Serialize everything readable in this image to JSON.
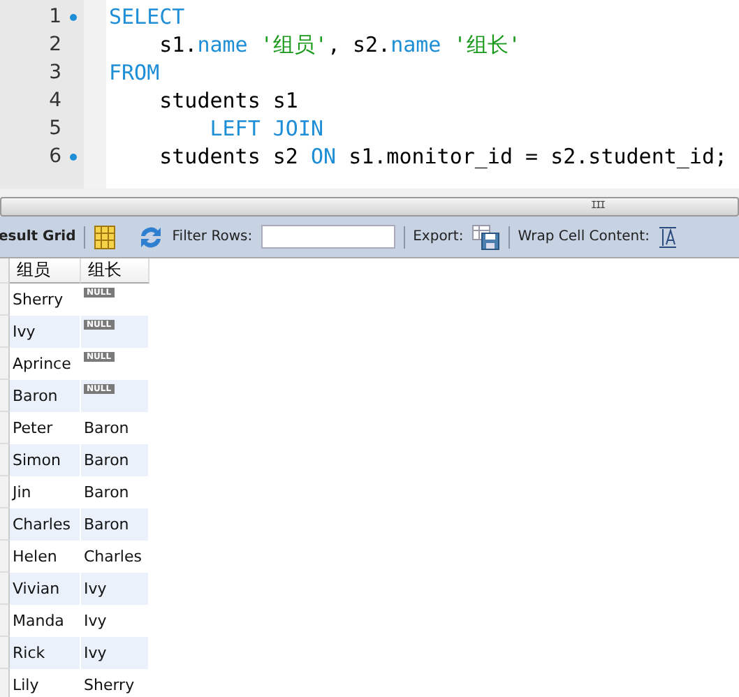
{
  "editor": {
    "lines": [
      {
        "number": "1",
        "marker": true,
        "tokens": [
          {
            "kind": "keyword",
            "text": "SELECT"
          }
        ]
      },
      {
        "number": "2",
        "marker": false,
        "tokens": [
          {
            "kind": "plain",
            "text": "    s1."
          },
          {
            "kind": "field",
            "text": "name"
          },
          {
            "kind": "string",
            "text": " '组员'"
          },
          {
            "kind": "plain",
            "text": ", s2."
          },
          {
            "kind": "field",
            "text": "name"
          },
          {
            "kind": "string",
            "text": " '组长'"
          }
        ]
      },
      {
        "number": "3",
        "marker": false,
        "tokens": [
          {
            "kind": "keyword",
            "text": "FROM"
          }
        ]
      },
      {
        "number": "4",
        "marker": false,
        "tokens": [
          {
            "kind": "plain",
            "text": "    students s1"
          }
        ]
      },
      {
        "number": "5",
        "marker": false,
        "tokens": [
          {
            "kind": "keyword",
            "text": "        LEFT JOIN"
          }
        ]
      },
      {
        "number": "6",
        "marker": true,
        "tokens": [
          {
            "kind": "plain",
            "text": "    students s2 "
          },
          {
            "kind": "keyword",
            "text": "ON"
          },
          {
            "kind": "plain",
            "text": " s1.monitor_id = s2.student_id;"
          }
        ]
      }
    ]
  },
  "scrollbar_grip": "III",
  "toolbar": {
    "title": "esult Grid",
    "filter_label": "Filter Rows:",
    "export_label": "Export:",
    "wrap_label": "Wrap Cell Content:"
  },
  "grid": {
    "columns": [
      "组员",
      "组长"
    ],
    "rows": [
      {
        "cells": [
          {
            "text": "Sherry",
            "null": false
          },
          {
            "text": "NULL",
            "null": true
          }
        ]
      },
      {
        "cells": [
          {
            "text": "Ivy",
            "null": false
          },
          {
            "text": "NULL",
            "null": true
          }
        ]
      },
      {
        "cells": [
          {
            "text": "Aprince",
            "null": false
          },
          {
            "text": "NULL",
            "null": true
          }
        ]
      },
      {
        "cells": [
          {
            "text": "Baron",
            "null": false
          },
          {
            "text": "NULL",
            "null": true
          }
        ]
      },
      {
        "cells": [
          {
            "text": "Peter",
            "null": false
          },
          {
            "text": "Baron",
            "null": false
          }
        ]
      },
      {
        "cells": [
          {
            "text": "Simon",
            "null": false
          },
          {
            "text": "Baron",
            "null": false
          }
        ]
      },
      {
        "cells": [
          {
            "text": "Jin",
            "null": false
          },
          {
            "text": "Baron",
            "null": false
          }
        ]
      },
      {
        "cells": [
          {
            "text": "Charles",
            "null": false
          },
          {
            "text": "Baron",
            "null": false
          }
        ]
      },
      {
        "cells": [
          {
            "text": "Helen",
            "null": false
          },
          {
            "text": "Charles",
            "null": false
          }
        ]
      },
      {
        "cells": [
          {
            "text": "Vivian",
            "null": false
          },
          {
            "text": "Ivy",
            "null": false
          }
        ]
      },
      {
        "cells": [
          {
            "text": "Manda",
            "null": false
          },
          {
            "text": "Ivy",
            "null": false
          }
        ]
      },
      {
        "cells": [
          {
            "text": "Rick",
            "null": false
          },
          {
            "text": "Ivy",
            "null": false
          }
        ]
      },
      {
        "cells": [
          {
            "text": "Lily",
            "null": false
          },
          {
            "text": "Sherry",
            "null": false
          }
        ]
      }
    ]
  }
}
